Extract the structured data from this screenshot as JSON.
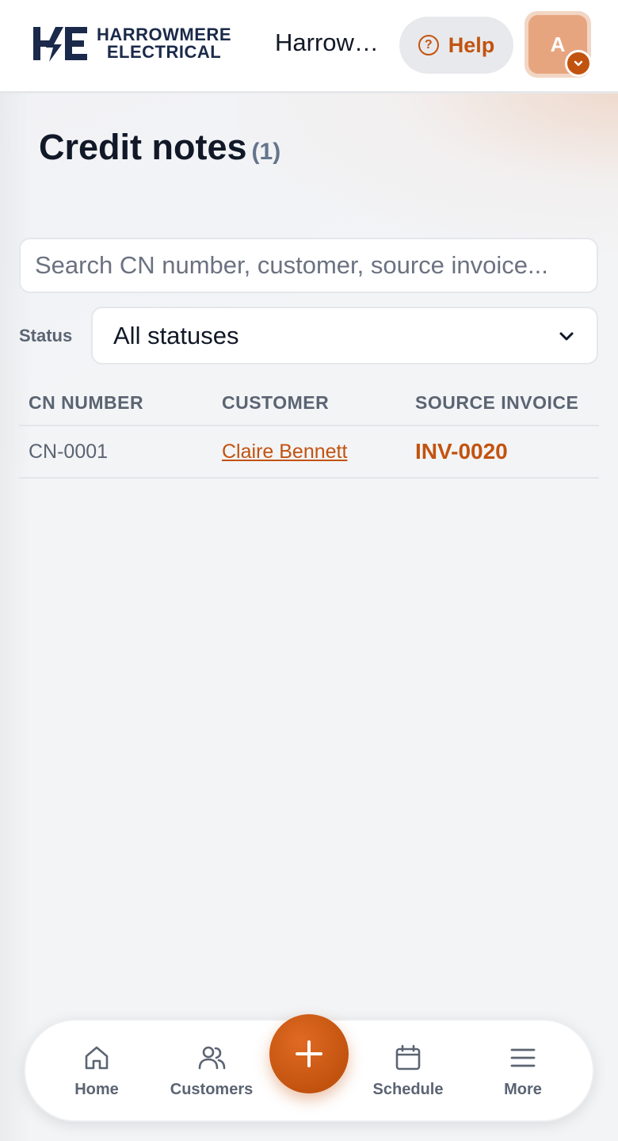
{
  "header": {
    "brand_line1": "HARROWMERE",
    "brand_line2": "ELECTRICAL",
    "org_name": "Harrowmere Electrical",
    "help_label": "Help",
    "avatar_initial": "A"
  },
  "page": {
    "title": "Credit notes",
    "count": "(1)"
  },
  "search": {
    "placeholder": "Search CN number, customer, source invoice...",
    "value": ""
  },
  "filter": {
    "label": "Status",
    "selected": "All statuses"
  },
  "table": {
    "columns": [
      "CN NUMBER",
      "CUSTOMER",
      "SOURCE INVOICE"
    ],
    "rows": [
      {
        "cn_number": "CN-0001",
        "customer": "Claire Bennett",
        "source_invoice": "INV-0020"
      }
    ]
  },
  "bottom_nav": {
    "items": [
      {
        "label": "Home",
        "icon": "home-icon"
      },
      {
        "label": "Customers",
        "icon": "users-icon"
      },
      {
        "label": "Schedule",
        "icon": "calendar-icon"
      },
      {
        "label": "More",
        "icon": "menu-icon"
      }
    ],
    "fab_icon": "plus-icon"
  },
  "colors": {
    "accent": "#c2530f",
    "brand_navy": "#1b2a4a",
    "text_muted": "#5b6472"
  }
}
